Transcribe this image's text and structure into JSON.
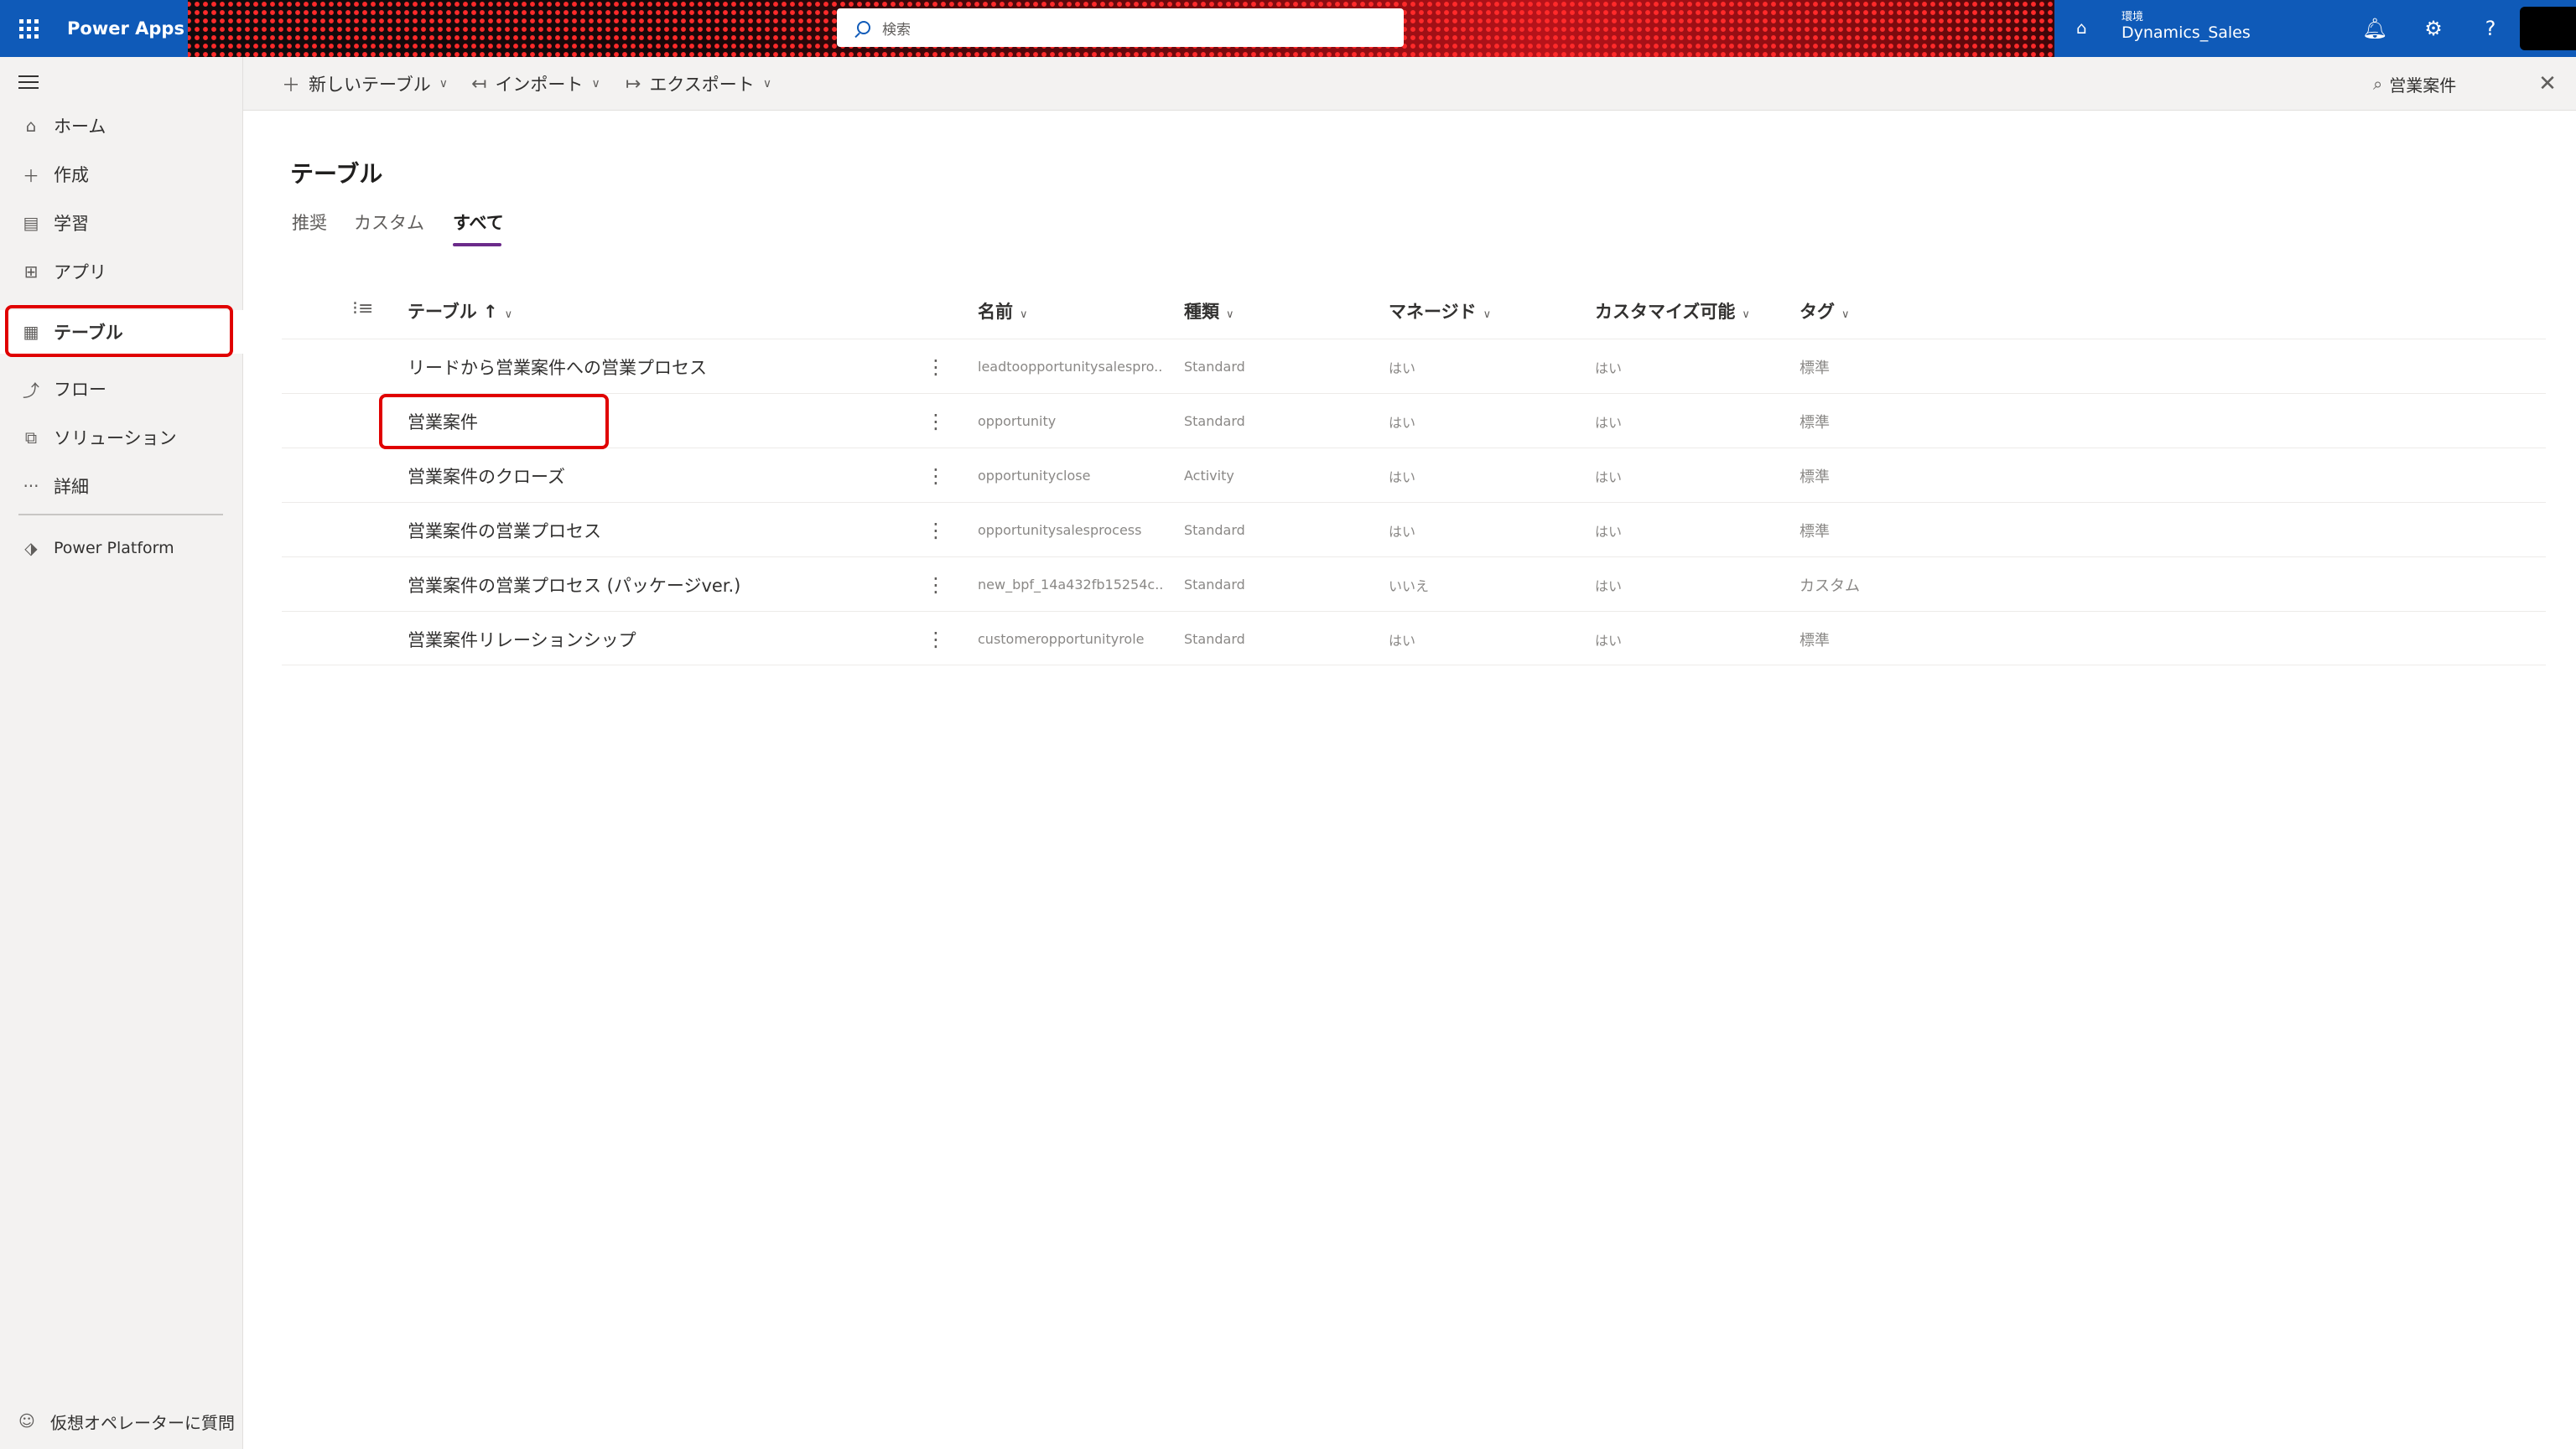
{
  "topbar": {
    "app_name": "Power Apps",
    "search_placeholder": "検索",
    "environment_label": "環境",
    "environment_name": "Dynamics_Sales",
    "icons": [
      "waffle-icon",
      "environment-icon",
      "bell-icon",
      "gear-icon",
      "help-icon"
    ]
  },
  "sidebar": {
    "items": [
      {
        "label": "ホーム",
        "icon": "home-icon"
      },
      {
        "label": "作成",
        "icon": "plus-icon"
      },
      {
        "label": "学習",
        "icon": "book-icon"
      },
      {
        "label": "アプリ",
        "icon": "apps-icon"
      },
      {
        "label": "テーブル",
        "icon": "table-icon",
        "selected": true
      },
      {
        "label": "フロー",
        "icon": "flow-icon"
      },
      {
        "label": "ソリューション",
        "icon": "solution-icon"
      },
      {
        "label": "詳細",
        "icon": "more-icon"
      },
      {
        "label": "Power Platform",
        "icon": "power-platform-icon"
      }
    ],
    "bottom_label": "仮想オペレーターに質問"
  },
  "commandbar": {
    "new_table": "新しいテーブル",
    "import": "インポート",
    "export": "エクスポート",
    "search_value": "営業案件"
  },
  "main": {
    "title": "テーブル",
    "tabs": [
      {
        "label": "推奨"
      },
      {
        "label": "カスタム"
      },
      {
        "label": "すべて",
        "active": true
      }
    ],
    "columns": {
      "table": "テーブル ↑",
      "name": "名前",
      "kind": "種類",
      "managed": "マネージド",
      "customizable": "カスタマイズ可能",
      "tag": "タグ"
    },
    "rows": [
      {
        "table": "リードから営業案件への営業プロセス",
        "name": "leadtoopportunitysalespro...",
        "kind": "Standard",
        "managed": "はい",
        "customizable": "はい",
        "tag": "標準"
      },
      {
        "table": "営業案件",
        "name": "opportunity",
        "kind": "Standard",
        "managed": "はい",
        "customizable": "はい",
        "tag": "標準"
      },
      {
        "table": "営業案件のクローズ",
        "name": "opportunityclose",
        "kind": "Activity",
        "managed": "はい",
        "customizable": "はい",
        "tag": "標準"
      },
      {
        "table": "営業案件の営業プロセス",
        "name": "opportunitysalesprocess",
        "kind": "Standard",
        "managed": "はい",
        "customizable": "はい",
        "tag": "標準"
      },
      {
        "table": "営業案件の営業プロセス (パッケージver.)",
        "name": "new_bpf_14a432fb15254c...",
        "kind": "Standard",
        "managed": "いいえ",
        "customizable": "はい",
        "tag": "カスタム"
      },
      {
        "table": "営業案件リレーションシップ",
        "name": "customeropportunityrole",
        "kind": "Standard",
        "managed": "はい",
        "customizable": "はい",
        "tag": "標準"
      }
    ]
  },
  "colors": {
    "brand_blue": "#0f5ab8",
    "highlight_red": "#e00000",
    "tab_accent": "#6b2a8a"
  }
}
